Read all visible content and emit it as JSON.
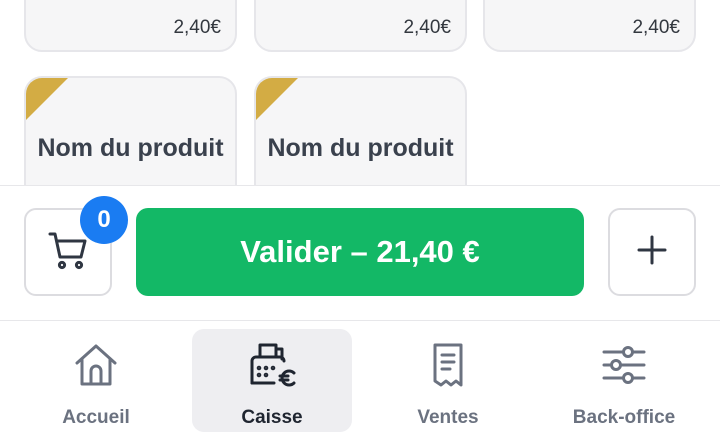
{
  "products_top_row": [
    {
      "price": "2,40€"
    },
    {
      "price": "2,40€"
    },
    {
      "price": "2,40€"
    }
  ],
  "products_second_row": [
    {
      "name": "Nom du produit"
    },
    {
      "name": "Nom du produit"
    }
  ],
  "cart": {
    "count": "0"
  },
  "validate": {
    "label": "Valider – 21,40 €"
  },
  "colors": {
    "accent_green": "#13b866",
    "badge_blue": "#1a7cf2",
    "corner_gold": "#d3ac44"
  },
  "nav": {
    "items": [
      {
        "label": "Accueil",
        "icon": "home-icon"
      },
      {
        "label": "Caisse",
        "icon": "cash-register-icon",
        "active": true
      },
      {
        "label": "Ventes",
        "icon": "receipt-icon"
      },
      {
        "label": "Back-office",
        "icon": "sliders-icon"
      }
    ]
  }
}
